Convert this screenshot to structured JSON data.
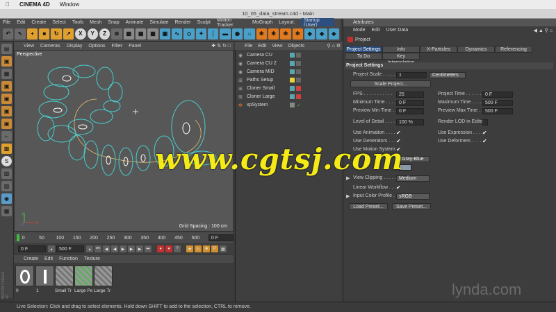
{
  "mac_menu": {
    "apple": "",
    "app": "CINEMA 4D",
    "window": "Window"
  },
  "title": "10_05_data_stream.c4d - Main",
  "menubar": [
    "File",
    "Edit",
    "Create",
    "Select",
    "Tools",
    "Mesh",
    "Snap",
    "Animate",
    "Simulate",
    "Render",
    "Sculpt",
    "Motion Tracker",
    "MoGraph"
  ],
  "layout": {
    "label": "Layout:",
    "value": "Startup (User)"
  },
  "viewport": {
    "menu": [
      "View",
      "Cameras",
      "Display",
      "Options",
      "Filter",
      "Panel"
    ],
    "label": "Perspective",
    "grid_spacing": "Grid Spacing : 100 cm",
    "axis_x": "X",
    "axis_y": "Y",
    "axis_z": "Z"
  },
  "timeline": {
    "ticks": [
      "0",
      "50",
      "100",
      "150",
      "200",
      "250",
      "300",
      "350",
      "400",
      "450",
      "500"
    ],
    "current": "0 F",
    "start": "0 F",
    "end": "500 F",
    "frame_field": "0 F"
  },
  "materials": {
    "menu": [
      "Create",
      "Edit",
      "Function",
      "Texture"
    ],
    "items": [
      "0",
      "1",
      "Small Tr",
      "Large Pe",
      "Large Tr"
    ]
  },
  "objects": {
    "menu": [
      "File",
      "Edit",
      "View",
      "Objects"
    ],
    "items": [
      {
        "name": "Camera CU",
        "color": "#5aa6b0"
      },
      {
        "name": "Camera CU 2",
        "color": "#5aa6b0"
      },
      {
        "name": "Camera MID",
        "color": "#5aa6b0"
      },
      {
        "name": "Paths Setup",
        "color": "#e8d43a"
      },
      {
        "name": "Cloner Small",
        "color": "#5aa6b0"
      },
      {
        "name": "Cloner Large",
        "color": "#5aa6b0"
      },
      {
        "name": "xpSystem",
        "color": "#e07030"
      }
    ]
  },
  "attributes": {
    "title": "Attributes",
    "menu": [
      "Mode",
      "Edit",
      "User Data"
    ],
    "object": "Project",
    "tabs1": [
      "Project Settings",
      "Info",
      "X-Particles",
      "Dynamics",
      "Referencing"
    ],
    "tabs2": [
      "To Do",
      "Key Interpolation"
    ],
    "section": "Project Settings",
    "project_scale": {
      "label": "Project Scale . . . . . .",
      "value": "1",
      "unit": "Centimeters"
    },
    "scale_button": "Scale Project...",
    "fps": {
      "label": "FPS . . . . . . . . . . .",
      "value": "25"
    },
    "project_time": {
      "label": "Project Time . . . . . .",
      "value": "0 F"
    },
    "min_time": {
      "label": "Minimum Time . . . . .",
      "value": "0 F"
    },
    "max_time": {
      "label": "Maximum Time . . . .",
      "value": "500 F"
    },
    "prev_min": {
      "label": "Preview Min Time . . .",
      "value": "0 F"
    },
    "prev_max": {
      "label": "Preview Max Time . .",
      "value": "500 F"
    },
    "lod": {
      "label": "Level of Detail . . . . .",
      "value": "100 %"
    },
    "render_lod": "Render LOD in Editor",
    "use_animation": "Use Animation . . . . .",
    "use_expression": "Use Expression . . . .",
    "use_generators": "Use Generators . . . .",
    "use_deformers": "Use Deformers . . . .",
    "use_motion": "Use Motion System . .",
    "default_color": "Gray-Blue",
    "view_clipping": {
      "label": "View Clipping . . . . .",
      "value": "Medium"
    },
    "linear_workflow": "Linear Workflow . . . .",
    "color_profile": {
      "label": "Input Color Profile . .",
      "value": "sRGB"
    },
    "load_preset": "Load Preset...",
    "save_preset": "Save Preset..."
  },
  "status": "Live Selection: Click and drag to select elements. Hold down SHIFT to add to the selection, CTRL to remove.",
  "watermark": "www.cgtsj.com",
  "brand": "lynda.com",
  "side_brand": "MAXON CINEMA 4D"
}
